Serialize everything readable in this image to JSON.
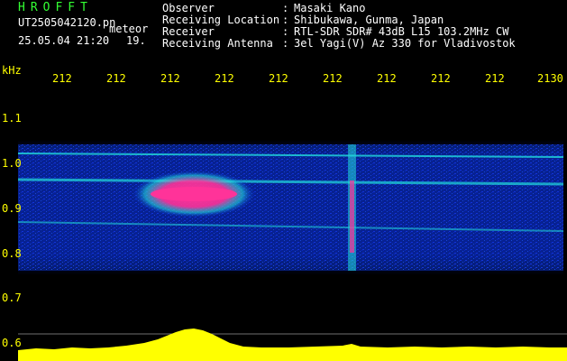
{
  "header": {
    "title": "HROFFT",
    "filename": "UT2505042120.pn",
    "tag": "meteor",
    "datetime": "25.05.04 21:20",
    "count": "19.",
    "meta": [
      {
        "label": "Observer",
        "value": "Masaki Kano"
      },
      {
        "label": "Receiving Location",
        "value": "Shibukawa, Gunma, Japan"
      },
      {
        "label": "Receiver",
        "value": "RTL-SDR SDR# 43dB L15 103.2MHz CW"
      },
      {
        "label": "Receiving Antenna",
        "value": "3el Yagi(V) Az 330 for Vladivostok"
      }
    ]
  },
  "axes": {
    "y_unit": "kHz",
    "x_ticks": [
      "212",
      "212",
      "212",
      "212",
      "212",
      "212",
      "212",
      "212",
      "212",
      "2130"
    ],
    "y_ticks": [
      "1.1",
      "1.0",
      "0.9",
      "0.8",
      "0.7",
      "0.6"
    ]
  },
  "colors": {
    "background": "#000000",
    "header_green": "#33ff33",
    "header_white": "#ffffff",
    "axis_yellow": "#ffff00",
    "noise_blue": "#0a2bd8",
    "signal_cyan": "#22dddd",
    "echo_pink": "#ff3399"
  }
}
